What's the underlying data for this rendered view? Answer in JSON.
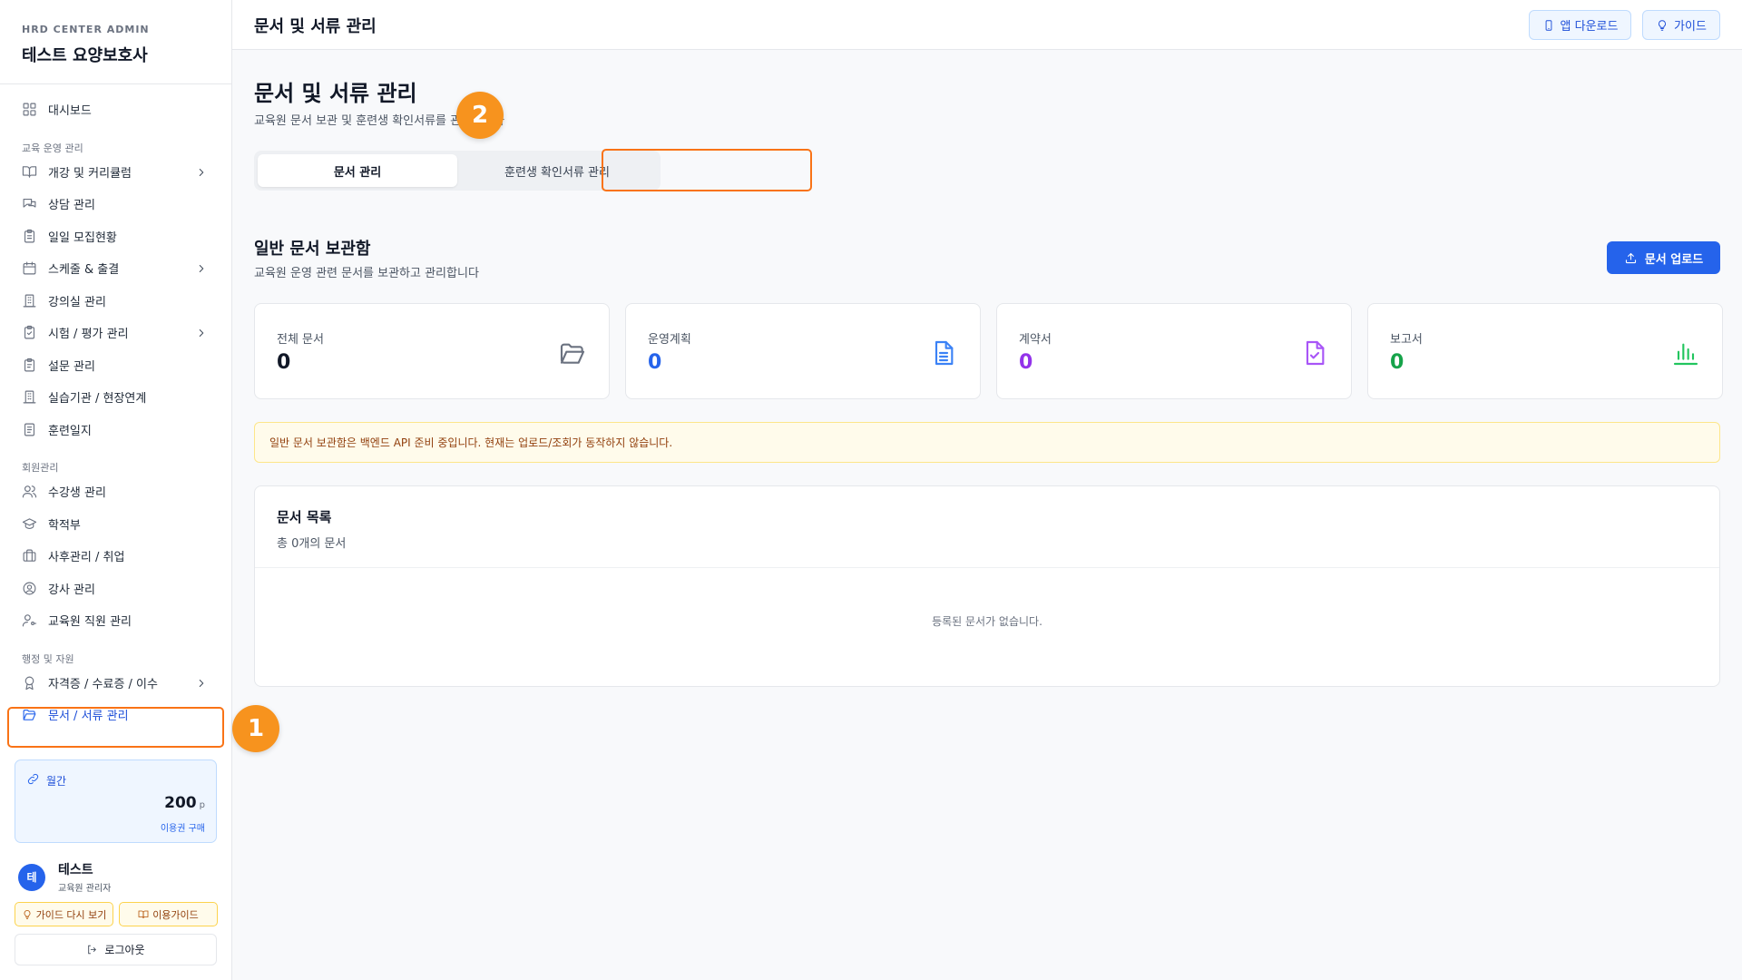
{
  "app": {
    "org": "HRD CENTER ADMIN",
    "name": "테스트 요양보호사"
  },
  "sidebar": {
    "dashboard": "대시보드",
    "sections": {
      "education": "교육 운영 관리",
      "members": "회원관리",
      "admin": "행정 및 자원"
    },
    "items": {
      "curriculum": "개강 및 커리큘럼",
      "consulting": "상담 관리",
      "daily_recruit": "일일 모집현황",
      "schedule": "스케줄 & 출결",
      "classroom": "강의실 관리",
      "exam": "시험 / 평가 관리",
      "survey": "설문 관리",
      "practice": "실습기관 / 현장연계",
      "training_log": "훈련일지",
      "students": "수강생 관리",
      "records": "학적부",
      "aftercare": "사후관리 / 취업",
      "instructors": "강사 관리",
      "staff": "교육원 직원 관리",
      "certificates": "자격증 / 수료증 / 이수",
      "documents": "문서 / 서류 관리"
    }
  },
  "plan": {
    "label": "월간",
    "points": "200",
    "unit": "p",
    "buy": "이용권 구매"
  },
  "user": {
    "initial": "테",
    "name": "테스트",
    "role": "교육원 관리자"
  },
  "guide": {
    "rewatch": "가이드 다시 보기",
    "usage": "이용가이드"
  },
  "logout": "로그아웃",
  "topbar": {
    "title": "문서 및 서류 관리",
    "app_download": "앱 다운로드",
    "guide": "가이드"
  },
  "page": {
    "title": "문서 및 서류 관리",
    "subtitle": "교육원 문서 보관 및 훈련생 확인서류를 관리합니다",
    "tabs": [
      "문서 관리",
      "훈련생 확인서류 관리"
    ]
  },
  "section": {
    "title": "일반 문서 보관함",
    "subtitle": "교육원 운영 관련 문서를 보관하고 관리합니다",
    "upload": "문서 업로드"
  },
  "stats": [
    {
      "label": "전체 문서",
      "value": "0",
      "color": "#111827",
      "icon": "folder-icon"
    },
    {
      "label": "운영계획",
      "value": "0",
      "color": "#2563eb",
      "icon": "document-icon"
    },
    {
      "label": "계약서",
      "value": "0",
      "color": "#9333ea",
      "icon": "document-check-icon"
    },
    {
      "label": "보고서",
      "value": "0",
      "color": "#16a34a",
      "icon": "bar-chart-icon"
    }
  ],
  "notice": "일반 문서 보관함은 백엔드 API 준비 중입니다. 현재는 업로드/조회가 동작하지 않습니다.",
  "list": {
    "title": "문서 목록",
    "count": "총 0개의 문서",
    "empty": "등록된 문서가 없습니다."
  },
  "markers": [
    "1",
    "2"
  ],
  "colors": {
    "accent": "#2563eb",
    "highlight": "#f97316",
    "marker": "#f7931e"
  }
}
